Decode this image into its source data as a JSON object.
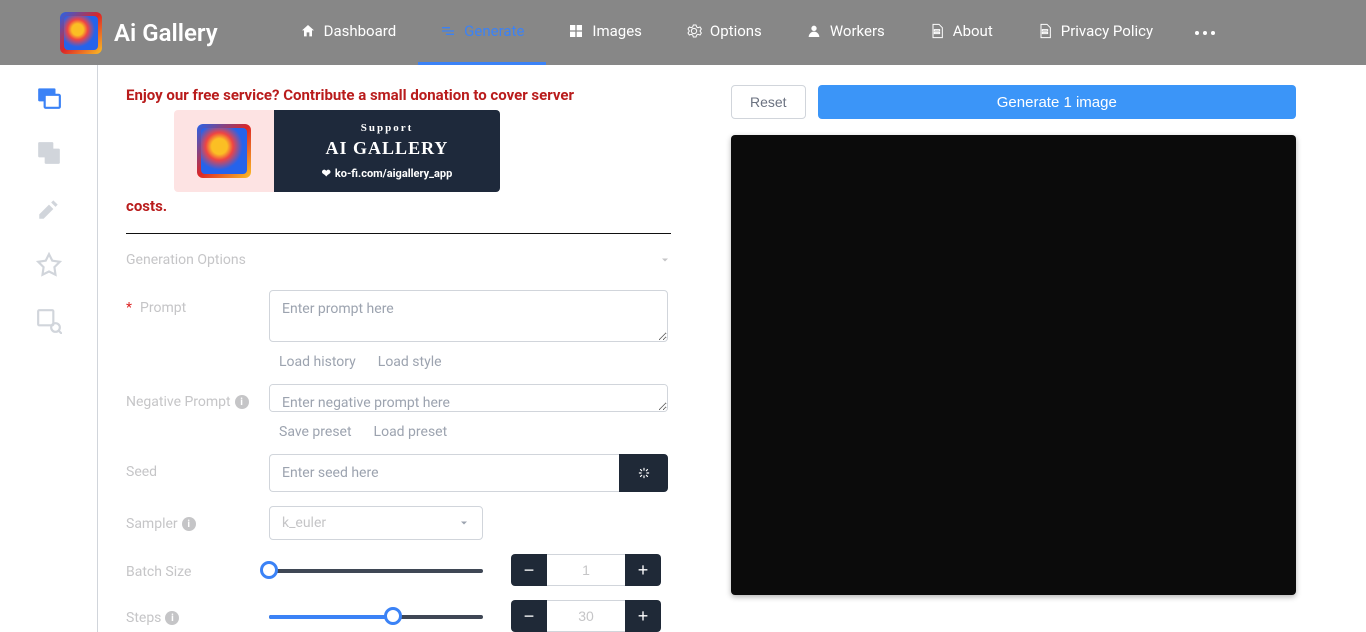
{
  "brand": "Ai Gallery",
  "nav": {
    "dashboard": "Dashboard",
    "generate": "Generate",
    "images": "Images",
    "options": "Options",
    "workers": "Workers",
    "about": "About",
    "privacy": "Privacy Policy"
  },
  "donation": {
    "prefix": "Enjoy our free service? Contribute a small donation to cover server ",
    "suffix": "costs.",
    "support": "Support",
    "title": "AI GALLERY",
    "kofi": "ko-fi.com/aigallery_app"
  },
  "section": "Generation Options",
  "labels": {
    "prompt": "Prompt",
    "negative": "Negative Prompt",
    "seed": "Seed",
    "sampler": "Sampler",
    "batch": "Batch Size",
    "steps": "Steps"
  },
  "placeholders": {
    "prompt": "Enter prompt here",
    "negative": "Enter negative prompt here",
    "seed": "Enter seed here"
  },
  "links": {
    "loadHistory": "Load history",
    "loadStyle": "Load style",
    "savePreset": "Save preset",
    "loadPreset": "Load preset"
  },
  "sampler": {
    "value": "k_euler"
  },
  "batch": {
    "value": "1",
    "fillPct": 0
  },
  "steps": {
    "value": "30",
    "fillPct": 58
  },
  "actions": {
    "reset": "Reset",
    "generate": "Generate 1 image"
  }
}
